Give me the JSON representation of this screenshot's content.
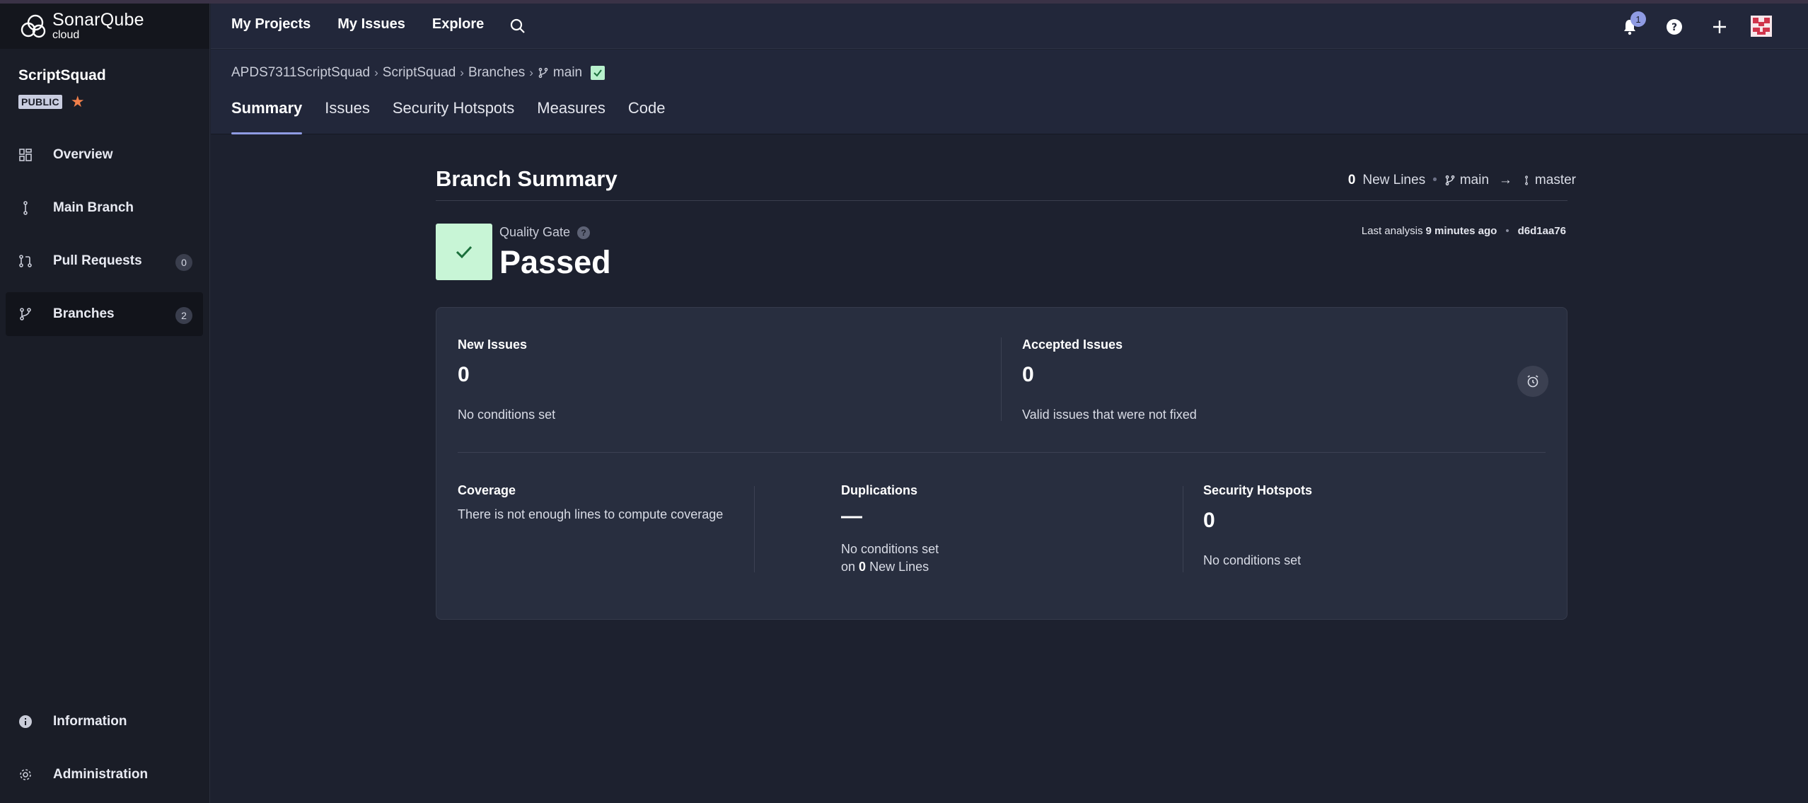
{
  "brand": {
    "name_line1": "SonarQube",
    "name_line2": "cloud"
  },
  "project": {
    "name": "ScriptSquad",
    "visibility": "PUBLIC"
  },
  "sidebar": {
    "items": [
      {
        "label": "Overview",
        "icon": "overview-icon"
      },
      {
        "label": "Main Branch",
        "icon": "main-branch-icon"
      },
      {
        "label": "Pull Requests",
        "icon": "pull-request-icon",
        "count": "0"
      },
      {
        "label": "Branches",
        "icon": "branch-icon",
        "count": "2",
        "active": true
      }
    ],
    "bottom_items": [
      {
        "label": "Information",
        "icon": "info-icon"
      },
      {
        "label": "Administration",
        "icon": "gear-icon"
      }
    ]
  },
  "topnav": {
    "links": [
      "My Projects",
      "My Issues",
      "Explore"
    ],
    "notifications_count": "1"
  },
  "breadcrumb": {
    "org": "APDS7311ScriptSquad",
    "project": "ScriptSquad",
    "section": "Branches",
    "branch": "main"
  },
  "tabs": [
    "Summary",
    "Issues",
    "Security Hotspots",
    "Measures",
    "Code"
  ],
  "summary": {
    "title": "Branch Summary",
    "new_lines_count": "0",
    "new_lines_label": "New Lines",
    "branch": "main",
    "target_branch": "master",
    "quality_gate_label": "Quality Gate",
    "quality_gate_status": "Passed",
    "last_analysis_prefix": "Last analysis",
    "last_analysis_time": "9 minutes ago",
    "commit": "d6d1aa76"
  },
  "metrics": {
    "new_issues": {
      "title": "New Issues",
      "value": "0",
      "sub": "No conditions set"
    },
    "accepted_issues": {
      "title": "Accepted Issues",
      "value": "0",
      "sub": "Valid issues that were not fixed"
    },
    "coverage": {
      "title": "Coverage",
      "sub": "There is not enough lines to compute coverage"
    },
    "duplications": {
      "title": "Duplications",
      "value": "—",
      "sub1": "No conditions set",
      "sub2_prefix": "on",
      "sub2_count": "0",
      "sub2_suffix": "New Lines"
    },
    "security_hotspots": {
      "title": "Security Hotspots",
      "value": "0",
      "sub": "No conditions set"
    }
  },
  "colors": {
    "accent": "#8f9be3",
    "passed": "#c8f5d6",
    "star": "#f07f4a"
  }
}
